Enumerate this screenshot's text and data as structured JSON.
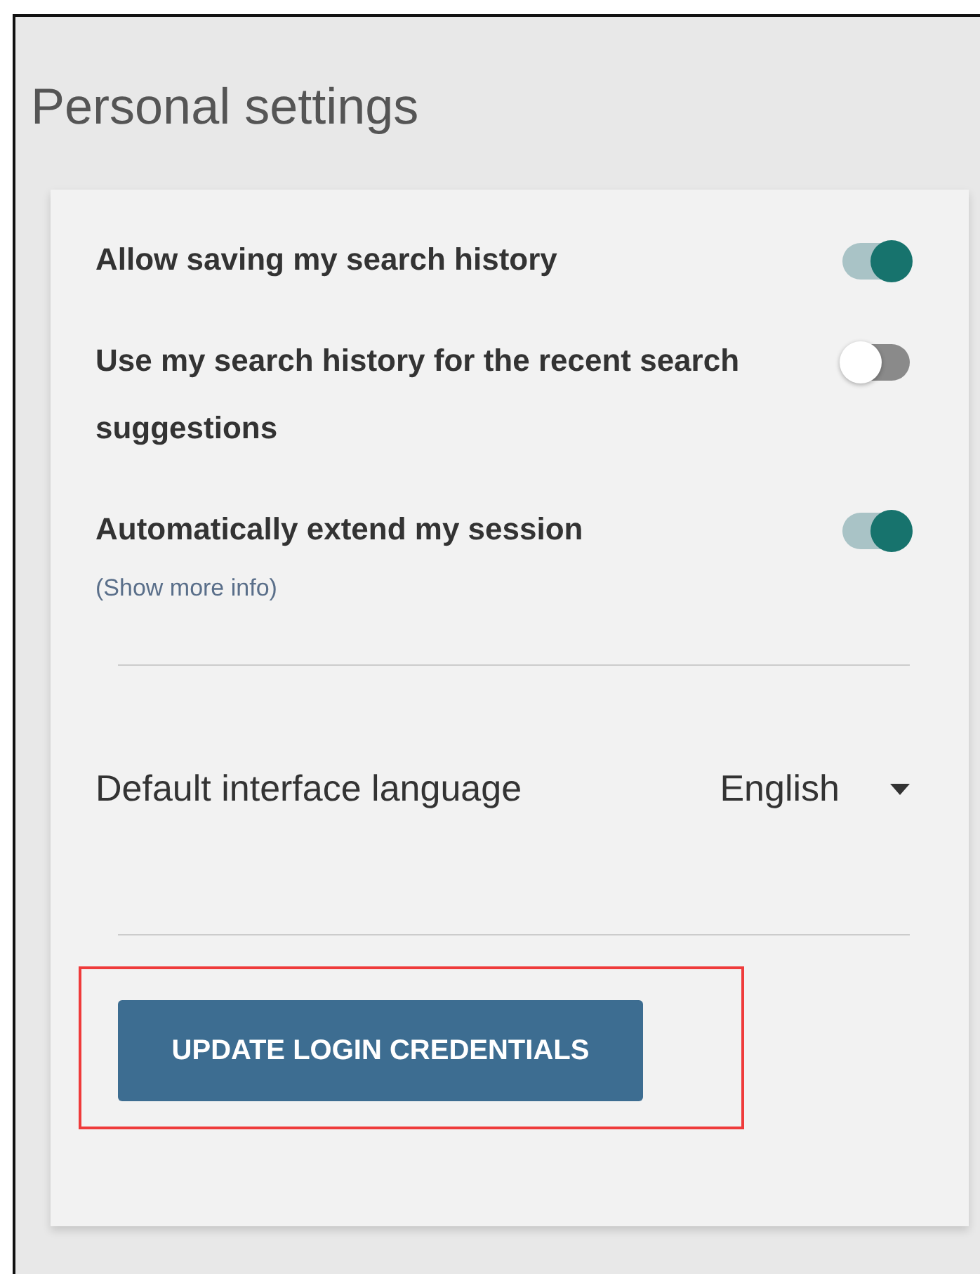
{
  "title": "Personal settings",
  "settings": [
    {
      "label": "Allow saving my search history",
      "on": true
    },
    {
      "label": "Use my search history for the recent search suggestions",
      "on": false
    },
    {
      "label": "Automatically extend my session",
      "on": true,
      "link": "(Show more info)"
    }
  ],
  "language": {
    "label": "Default interface language",
    "value": "English"
  },
  "update_button": {
    "label": "UPDATE LOGIN CREDENTIALS",
    "highlighted": true
  }
}
